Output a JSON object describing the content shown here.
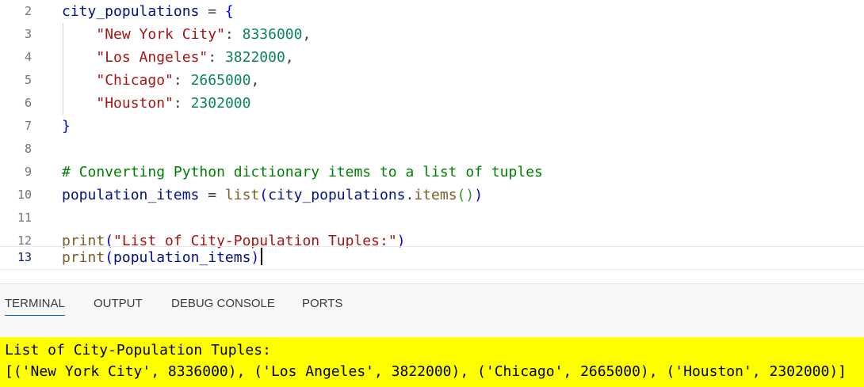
{
  "editor": {
    "current_line": "13",
    "lines": [
      {
        "num": "2",
        "tokens": [
          "city_populations",
          " = ",
          "{"
        ]
      },
      {
        "num": "3",
        "tokens": [
          "    ",
          "\"New York City\"",
          ": ",
          "8336000",
          ","
        ]
      },
      {
        "num": "4",
        "tokens": [
          "    ",
          "\"Los Angeles\"",
          ": ",
          "3822000",
          ","
        ]
      },
      {
        "num": "5",
        "tokens": [
          "    ",
          "\"Chicago\"",
          ": ",
          "2665000",
          ","
        ]
      },
      {
        "num": "6",
        "tokens": [
          "    ",
          "\"Houston\"",
          ": ",
          "2302000"
        ]
      },
      {
        "num": "7",
        "tokens": [
          "}"
        ]
      },
      {
        "num": "8",
        "tokens": []
      },
      {
        "num": "9",
        "tokens": [
          "# Converting Python dictionary items to a list of tuples"
        ]
      },
      {
        "num": "10",
        "tokens": [
          "population_items",
          " = ",
          "list",
          "(",
          "city_populations",
          ".",
          "items",
          "()",
          ")"
        ]
      },
      {
        "num": "11",
        "tokens": []
      },
      {
        "num": "12",
        "tokens": [
          "print",
          "(",
          "\"List of City-Population Tuples:\"",
          ")"
        ]
      },
      {
        "num": "13",
        "tokens": [
          "print",
          "(",
          "population_items",
          ")"
        ]
      }
    ]
  },
  "panel": {
    "tabs": [
      {
        "label": "TERMINAL",
        "active": true
      },
      {
        "label": "OUTPUT",
        "active": false
      },
      {
        "label": "DEBUG CONSOLE",
        "active": false
      },
      {
        "label": "PORTS",
        "active": false
      }
    ]
  },
  "terminal": {
    "lines": [
      "List of City-Population Tuples:",
      "[('New York City', 8336000), ('Los Angeles', 3822000), ('Chicago', 2665000), ('Houston', 2302000)]"
    ]
  },
  "colors": {
    "variable": "#001080",
    "string": "#a31515",
    "number": "#098658",
    "comment": "#008000",
    "function": "#795e26",
    "terminal_highlight": "#ffff00",
    "active_tab_underline": "#005fb8"
  }
}
